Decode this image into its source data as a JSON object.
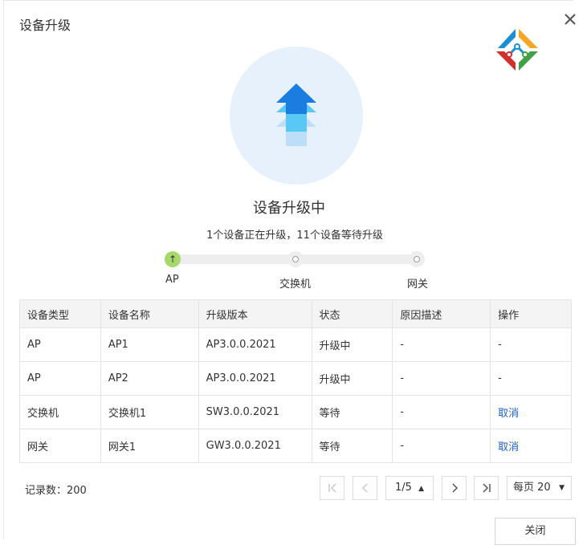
{
  "dialog": {
    "title": "设备升级",
    "close_icon": "close-icon"
  },
  "hero": {
    "icon": "upgrade-arrow-icon",
    "colors": {
      "circle": "#e6f1fc",
      "arrow_top": "#1b7de0",
      "arrow_mid": "#5ac8f5",
      "arrow_bottom": "#b7dcf8"
    }
  },
  "status": {
    "title": "设备升级中",
    "summary": "1个设备正在升级，11个设备等待升级"
  },
  "steps": [
    {
      "label": "AP",
      "state": "active",
      "icon": "up-arrow-icon"
    },
    {
      "label": "交换机",
      "state": "pending"
    },
    {
      "label": "网关",
      "state": "pending"
    }
  ],
  "table": {
    "columns": [
      "设备类型",
      "设备名称",
      "升级版本",
      "状态",
      "原因描述",
      "操作"
    ],
    "rows": [
      [
        "AP",
        "AP1",
        "AP3.0.0.2021",
        "升级中",
        "-",
        "-"
      ],
      [
        "AP",
        "AP2",
        "AP3.0.0.2021",
        "升级中",
        "-",
        "-"
      ],
      [
        "交换机",
        "交换机1",
        "SW3.0.0.2021",
        "等待",
        "-",
        "取消"
      ],
      [
        "网关",
        "网关1",
        "GW3.0.0.2021",
        "等待",
        "-",
        "取消"
      ]
    ]
  },
  "footer": {
    "records": "记录数：200",
    "page": "1/5",
    "per_page": "每页 20",
    "close_label": "关闭"
  },
  "accent": {
    "link": "#1f62c8",
    "active_step": "#a6d96a"
  }
}
